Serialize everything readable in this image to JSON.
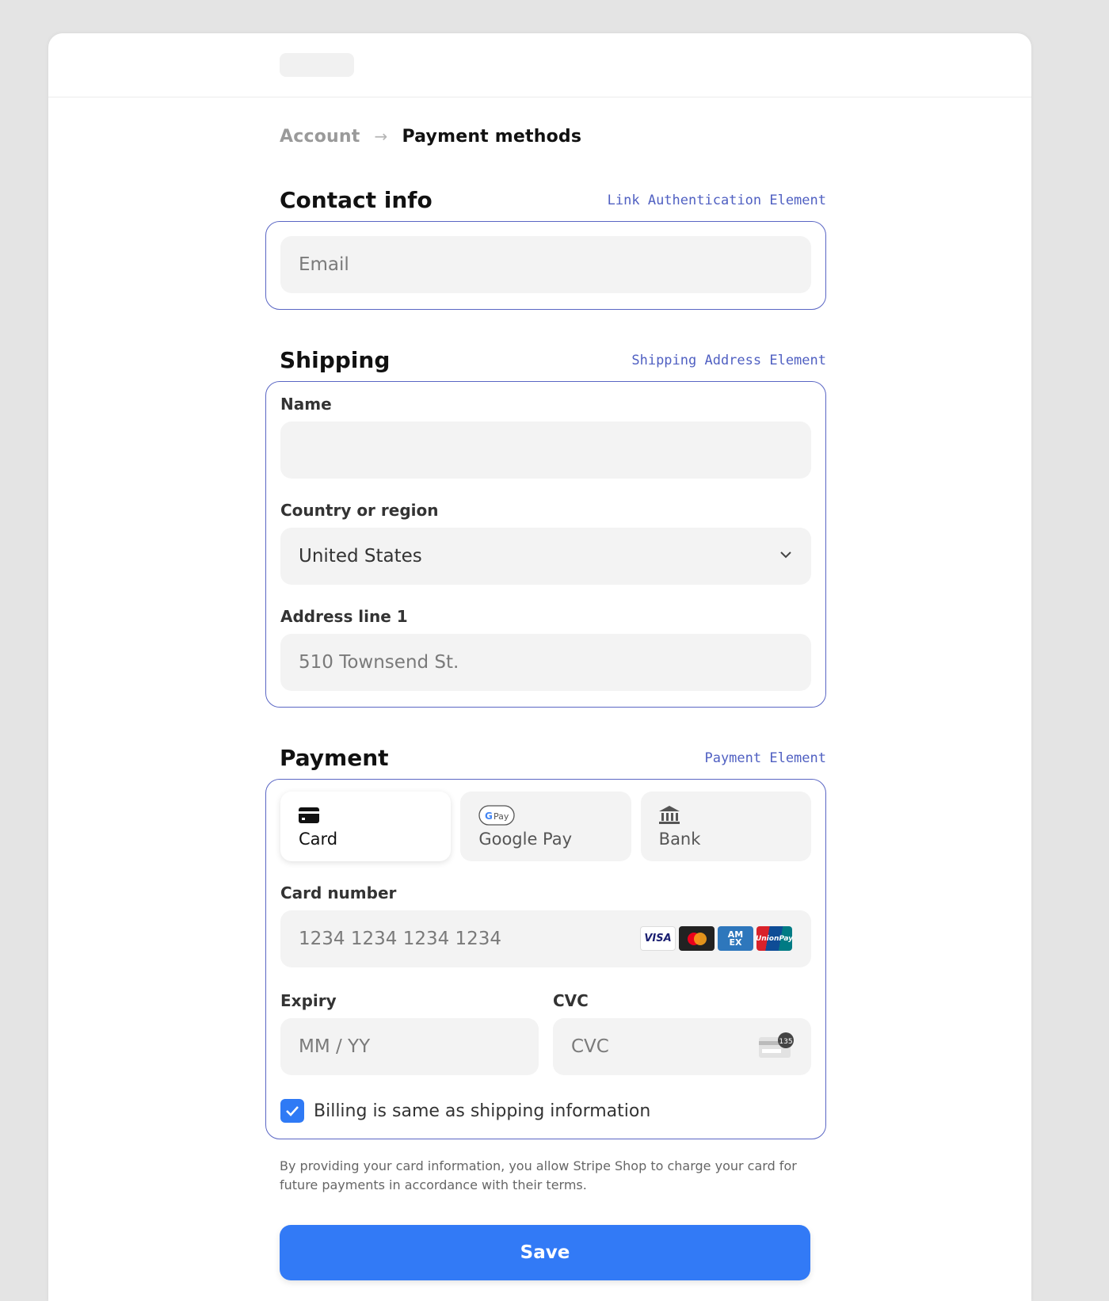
{
  "breadcrumb": {
    "parent": "Account",
    "separator": "→",
    "current": "Payment methods"
  },
  "contact": {
    "title": "Contact info",
    "tag": "Link Authentication Element",
    "email_placeholder": "Email"
  },
  "shipping": {
    "title": "Shipping",
    "tag": "Shipping Address Element",
    "name_label": "Name",
    "name_value": "",
    "country_label": "Country or region",
    "country_value": "United States",
    "address_label": "Address line 1",
    "address_placeholder": "510 Townsend St."
  },
  "payment": {
    "title": "Payment",
    "tag": "Payment Element",
    "methods": [
      {
        "label": "Card",
        "icon": "credit-card-icon",
        "active": true
      },
      {
        "label": "Google Pay",
        "icon": "google-pay-icon",
        "active": false
      },
      {
        "label": "Bank",
        "icon": "bank-icon",
        "active": false
      }
    ],
    "card_number_label": "Card number",
    "card_number_placeholder": "1234 1234 1234 1234",
    "card_brands": [
      "VISA",
      "Mastercard",
      "AMEX",
      "UnionPay"
    ],
    "expiry_label": "Expiry",
    "expiry_placeholder": "MM / YY",
    "cvc_label": "CVC",
    "cvc_placeholder": "CVC",
    "cvc_hint": "135",
    "billing_same_label": "Billing is same as shipping information",
    "billing_same_checked": true
  },
  "disclaimer": "By providing your card information, you allow Stripe Shop to charge your card for future payments in accordance with their terms.",
  "save_label": "Save",
  "colors": {
    "accent": "#327af6",
    "panel_border": "#5a66c4",
    "tag_text": "#5060c2",
    "field_bg": "#f3f3f3",
    "page_bg": "#e4e4e4"
  }
}
